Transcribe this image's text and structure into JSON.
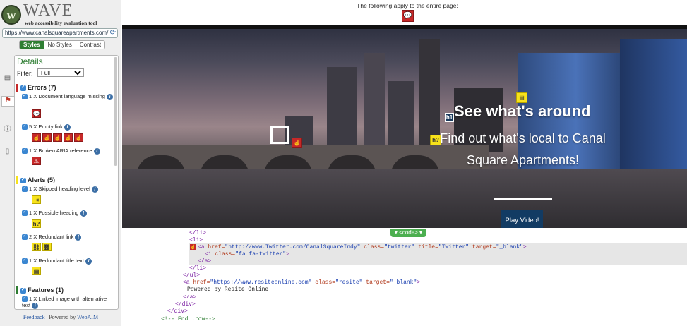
{
  "logo": {
    "word": "WAVE",
    "letter": "w",
    "tagline": "web accessibility evaluation tool"
  },
  "url": {
    "value": "https://www.canalsquareapartments.com/"
  },
  "view_tabs": [
    {
      "label": "Styles",
      "active": true
    },
    {
      "label": "No Styles",
      "active": false
    },
    {
      "label": "Contrast",
      "active": false
    }
  ],
  "panel": {
    "title": "Details",
    "filter_label": "Filter:",
    "filter_value": "Full",
    "sections": {
      "errors": {
        "label": "Errors (7)",
        "color": "#c62828",
        "items": [
          "1 X Document language missing",
          "5 X Empty link",
          "1 X Broken ARIA reference"
        ]
      },
      "alerts": {
        "label": "Alerts (5)",
        "color": "#f7e21b",
        "items": [
          "1 X Skipped heading level",
          "1 X Possible heading",
          "2 X Redundant link",
          "1 X Redundant title text"
        ]
      },
      "features": {
        "label": "Features (1)",
        "color": "#2e7d32",
        "items": [
          "1 X Linked image with alternative text"
        ]
      }
    }
  },
  "footer": {
    "feedback": "Feedback",
    "sep": " | ",
    "powered": "Powered by ",
    "webaim": "WebAIM"
  },
  "top_note": "The following apply to the entire page:",
  "hero": {
    "heading": "See what's around",
    "subtitle": "Find out what's local to Canal Square Apartments!",
    "button": "Play Video!",
    "h1_badge": "h1",
    "hq_badge": "h?"
  },
  "code_tab": "▾ <code> ▾",
  "code": {
    "l1": "</li>",
    "l2": "<li>",
    "l3_a": "<a ",
    "l3_href_n": "href=",
    "l3_href_v": "\"http://www.Twitter.com/CanalSquareIndy\"",
    "l3_class_n": " class=",
    "l3_class_v": "\"twitter\"",
    "l3_title_n": " title=",
    "l3_title_v": "\"Twitter\"",
    "l3_target_n": " target=",
    "l3_target_v": "\"_blank\"",
    "l3_end": ">",
    "l4_a": "<i ",
    "l4_class_n": "class=",
    "l4_class_v": "\"fa fa-twitter\"",
    "l4_end": ">",
    "l5": "</a>",
    "l6": "</li>",
    "l7": "</ul>",
    "l8_a": "<a ",
    "l8_href_n": "href=",
    "l8_href_v": "\"https://www.resiteonline.com\"",
    "l8_class_n": " class=",
    "l8_class_v": "\"resite\"",
    "l8_target_n": " target=",
    "l8_target_v": "\"_blank\"",
    "l8_end": ">",
    "l9": "Powered by Resite Online",
    "l10": "</a>",
    "l11": "</div>",
    "l12": "</div>",
    "l13": "<!-- End .row-->"
  }
}
